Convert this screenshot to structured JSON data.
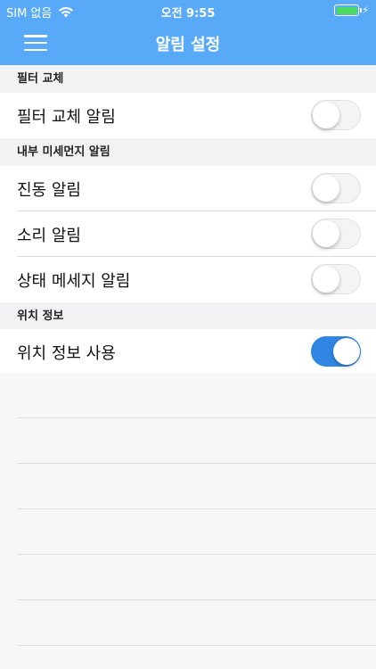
{
  "status": {
    "carrier": "SIM 없음",
    "time": "오전 9:55",
    "bolt": "⚡"
  },
  "nav": {
    "title": "알림 설정"
  },
  "sections": {
    "filter": {
      "header": "필터 교체",
      "rows": [
        {
          "label": "필터 교체 알림",
          "on": false
        }
      ]
    },
    "dust": {
      "header": "내부 미세먼지 알림",
      "rows": [
        {
          "label": "진동 알림",
          "on": false
        },
        {
          "label": "소리 알림",
          "on": false
        },
        {
          "label": "상태 메세지 알림",
          "on": false
        }
      ]
    },
    "location": {
      "header": "위치 정보",
      "rows": [
        {
          "label": "위치 정보 사용",
          "on": true
        }
      ]
    }
  },
  "colors": {
    "header": "#58a9f7",
    "toggle_on": "#2f85e2",
    "battery": "#4cd964"
  }
}
